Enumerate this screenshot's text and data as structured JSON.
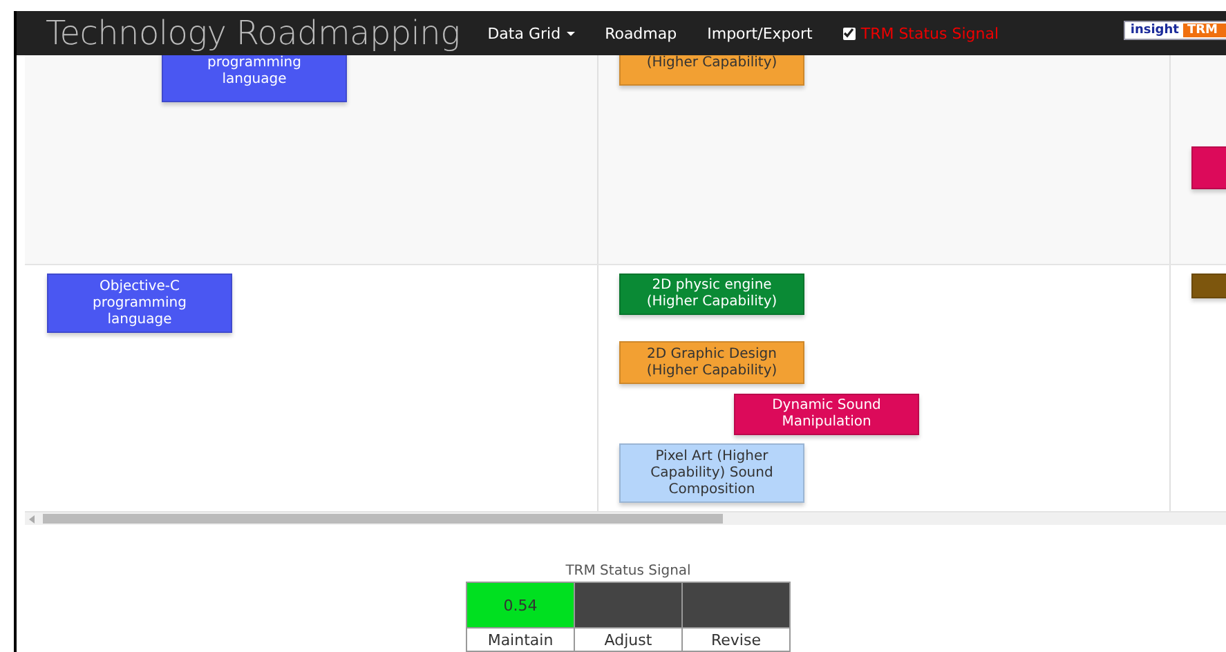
{
  "navbar": {
    "title": "Technology Roadmapping",
    "menu": [
      {
        "label": "Data Grid",
        "kind": "dropdown"
      },
      {
        "label": "Roadmap",
        "kind": "link"
      },
      {
        "label": "Import/Export",
        "kind": "link"
      },
      {
        "label": "TRM Status Signal",
        "kind": "checkbox",
        "checked": true
      }
    ],
    "logo": {
      "part_1": "insight",
      "part_2": "TRM"
    }
  },
  "roadmap": {
    "lanes": [
      {
        "cards": [
          {
            "lines": [
              "programming",
              "language"
            ],
            "color": "#4a57f2"
          },
          {
            "lines": [
              "(Higher Capability)"
            ],
            "color": "#f2a033"
          },
          {
            "color": "#dc0a5a"
          }
        ]
      },
      {
        "cards": [
          {
            "lines": [
              "Objective-C",
              "programming",
              "language"
            ],
            "color": "#4a57f2"
          },
          {
            "lines": [
              "2D physic engine",
              "(Higher Capability)"
            ],
            "color": "#0a8a35"
          },
          {
            "lines": [
              "2D Graphic Design",
              "(Higher Capability)"
            ],
            "color": "#f2a033"
          },
          {
            "lines": [
              "Dynamic Sound",
              "Manipulation"
            ],
            "color": "#dc0a5a"
          },
          {
            "lines": [
              "Pixel Art (Higher",
              "Capability) Sound",
              "Composition"
            ],
            "color": "#b5d5fa"
          },
          {
            "color": "#7d560d"
          }
        ]
      }
    ]
  },
  "status_signal": {
    "title": "TRM Status Signal",
    "value": "0.54",
    "cells": [
      {
        "label": "Maintain",
        "selected": true
      },
      {
        "label": "Adjust",
        "selected": false
      },
      {
        "label": "Revise",
        "selected": false
      }
    ]
  }
}
